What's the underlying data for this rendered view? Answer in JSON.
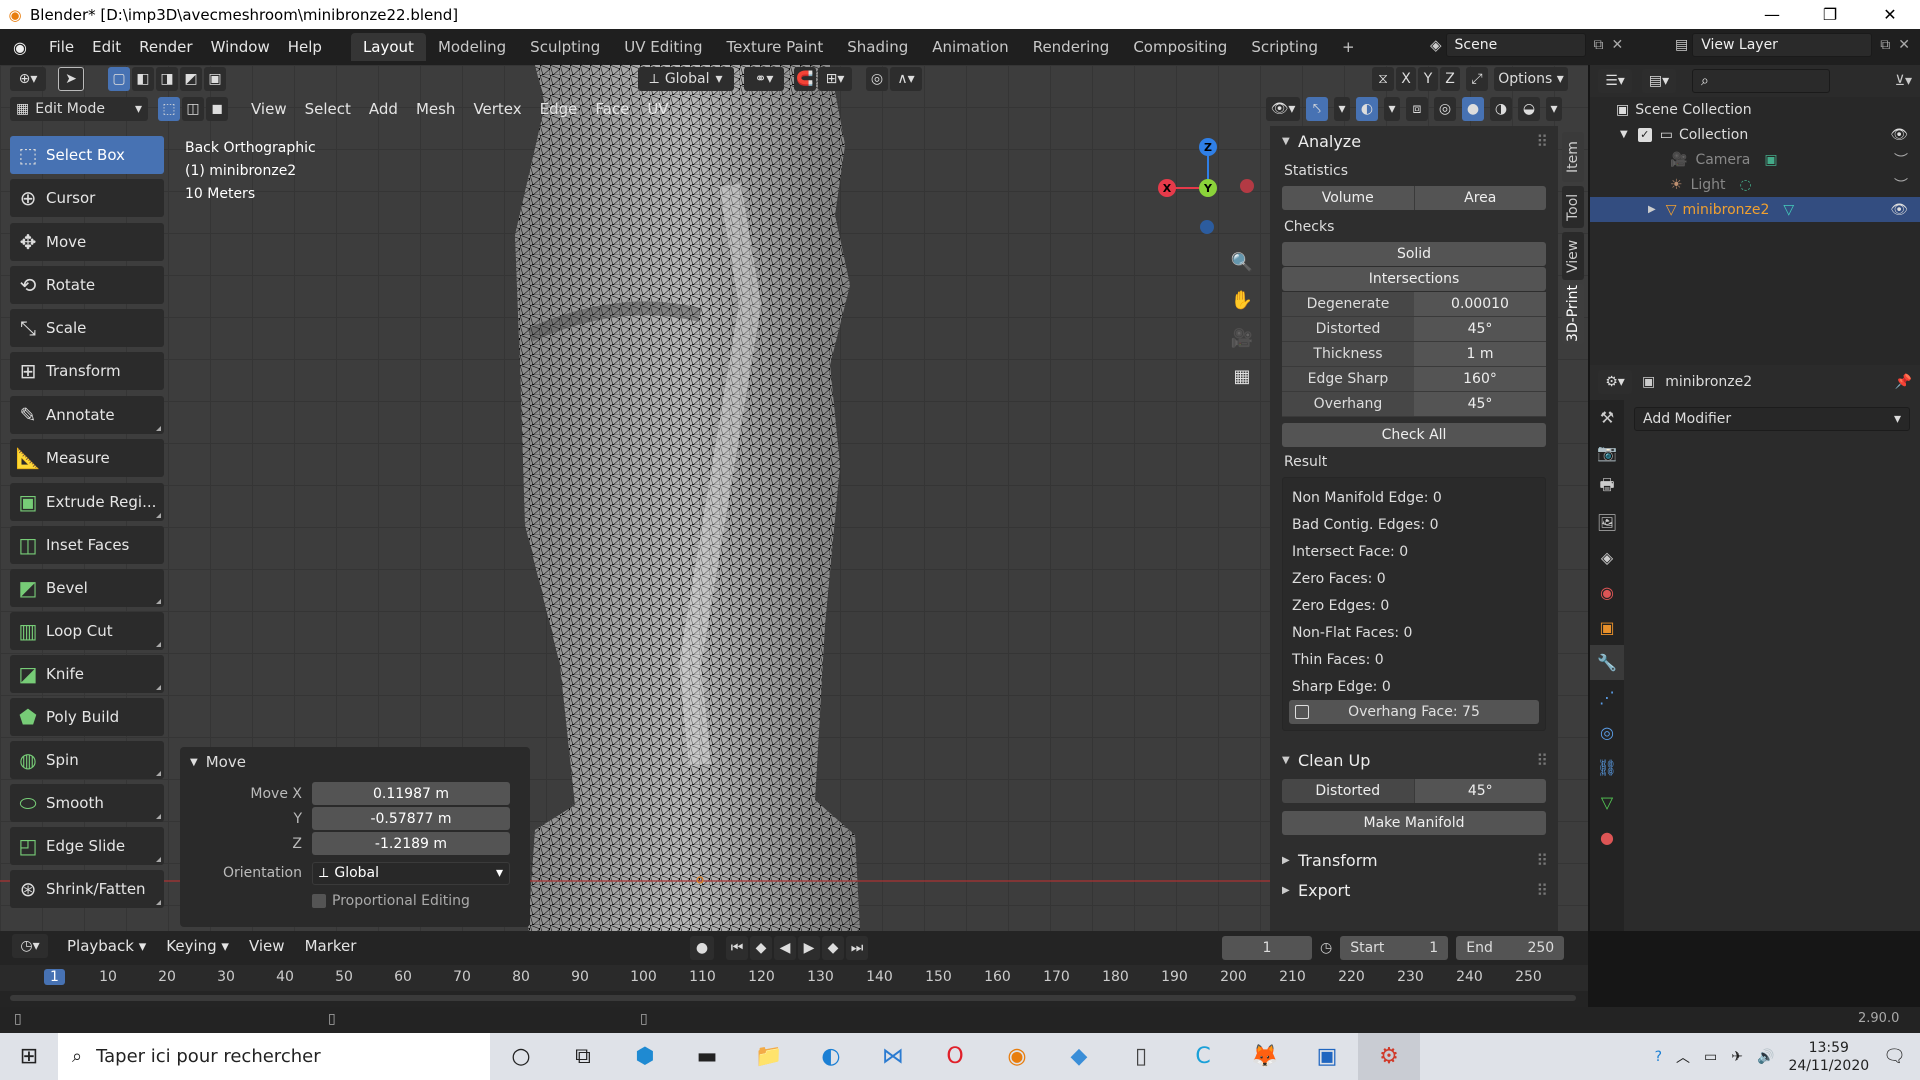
{
  "window": {
    "title": "Blender* [D:\\imp3D\\avecmeshroom\\minibronze22.blend]"
  },
  "menu": [
    "File",
    "Edit",
    "Render",
    "Window",
    "Help"
  ],
  "workspaces": [
    "Layout",
    "Modeling",
    "Sculpting",
    "UV Editing",
    "Texture Paint",
    "Shading",
    "Animation",
    "Rendering",
    "Compositing",
    "Scripting",
    "+"
  ],
  "scene": {
    "name": "Scene",
    "view_layer": "View Layer"
  },
  "header": {
    "transform_orientation": "Global",
    "options": "Options",
    "axes": [
      "X",
      "Y",
      "Z"
    ]
  },
  "viewport_header": {
    "mode": "Edit Mode",
    "menus": [
      "View",
      "Select",
      "Add",
      "Mesh",
      "Vertex",
      "Edge",
      "Face",
      "UV"
    ]
  },
  "info": {
    "view": "Back Orthographic",
    "object": "(1) minibronze2",
    "scale": "10 Meters"
  },
  "tools": [
    "Select Box",
    "Cursor",
    "Move",
    "Rotate",
    "Scale",
    "Transform",
    "Annotate",
    "Measure",
    "Extrude Regi...",
    "Inset Faces",
    "Bevel",
    "Loop Cut",
    "Knife",
    "Poly Build",
    "Spin",
    "Smooth",
    "Edge Slide",
    "Shrink/Fatten"
  ],
  "move_panel": {
    "title": "Move",
    "labels": {
      "x": "Move X",
      "y": "Y",
      "z": "Z",
      "orientation": "Orientation"
    },
    "x": "0.11987 m",
    "y": "-0.57877 m",
    "z": "-1.2189 m",
    "orientation": "Global",
    "proportional": "Proportional Editing"
  },
  "gizmo": {
    "z": "Z",
    "x": "X",
    "y": "Y"
  },
  "side_tabs": [
    "Item",
    "Tool",
    "View",
    "3D-Print"
  ],
  "npanel": {
    "analyze": "Analyze",
    "statistics": "Statistics",
    "volume": "Volume",
    "area": "Area",
    "checks": "Checks",
    "solid": "Solid",
    "intersections": "Intersections",
    "params": [
      {
        "k": "Degenerate",
        "v": "0.00010"
      },
      {
        "k": "Distorted",
        "v": "45°"
      },
      {
        "k": "Thickness",
        "v": "1 m"
      },
      {
        "k": "Edge Sharp",
        "v": "160°"
      },
      {
        "k": "Overhang",
        "v": "45°"
      }
    ],
    "check_all": "Check All",
    "result": "Result",
    "results": [
      "Non Manifold Edge: 0",
      "Bad Contig. Edges: 0",
      "Intersect Face: 0",
      "Zero Faces: 0",
      "Zero Edges: 0",
      "Non-Flat Faces: 0",
      "Thin Faces: 0",
      "Sharp Edge: 0"
    ],
    "overhang_face": "Overhang Face: 75",
    "cleanup": "Clean Up",
    "distorted": "Distorted",
    "distorted_val": "45°",
    "make_manifold": "Make Manifold",
    "transform": "Transform",
    "export": "Export"
  },
  "outliner": {
    "scene_collection": "Scene Collection",
    "collection": "Collection",
    "camera": "Camera",
    "light": "Light",
    "object": "minibronze2"
  },
  "properties": {
    "object": "minibronze2",
    "add_modifier": "Add Modifier"
  },
  "timeline": {
    "menus": [
      "Playback",
      "Keying",
      "View",
      "Marker"
    ],
    "current": "1",
    "start_label": "Start",
    "start": "1",
    "end_label": "End",
    "end": "250",
    "ticks": [
      "1",
      "10",
      "20",
      "30",
      "40",
      "50",
      "60",
      "70",
      "80",
      "90",
      "100",
      "110",
      "120",
      "130",
      "140",
      "150",
      "160",
      "170",
      "180",
      "190",
      "200",
      "210",
      "220",
      "230",
      "240",
      "250"
    ]
  },
  "status": {
    "version": "2.90.0"
  },
  "taskbar": {
    "search": "Taper ici pour rechercher",
    "time": "13:59",
    "date": "24/11/2020"
  },
  "colors": {
    "accent": "#4772b3",
    "selected": "#f0a030",
    "bg": "#3d3d3d"
  }
}
